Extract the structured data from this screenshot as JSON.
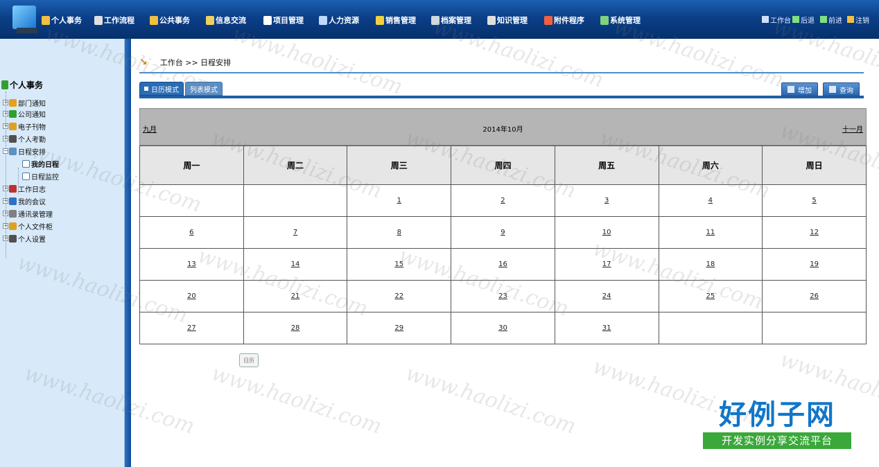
{
  "topnav": {
    "items": [
      {
        "label": "个人事务",
        "icon": "person-icon",
        "color": "#f0c040"
      },
      {
        "label": "工作流程",
        "icon": "workflow-icon",
        "color": "#e0e0e0"
      },
      {
        "label": "公共事务",
        "icon": "public-affairs-icon",
        "color": "#f0c040"
      },
      {
        "label": "信息交流",
        "icon": "message-icon",
        "color": "#f0d060"
      },
      {
        "label": "项目管理",
        "icon": "project-icon",
        "color": "#ffffff"
      },
      {
        "label": "人力资源",
        "icon": "hr-icon",
        "color": "#c0d8ff"
      },
      {
        "label": "销售管理",
        "icon": "sales-icon",
        "color": "#f0d040"
      },
      {
        "label": "档案管理",
        "icon": "archive-icon",
        "color": "#d0d8e0"
      },
      {
        "label": "知识管理",
        "icon": "knowledge-icon",
        "color": "#e0e0e0"
      },
      {
        "label": "附件程序",
        "icon": "attachment-icon",
        "color": "#f06040"
      },
      {
        "label": "系统管理",
        "icon": "system-icon",
        "color": "#80d080"
      }
    ],
    "right": [
      {
        "label": "工作台",
        "icon": "desk-icon"
      },
      {
        "label": "后退",
        "icon": "back-icon"
      },
      {
        "label": "前进",
        "icon": "forward-icon"
      },
      {
        "label": "注销",
        "icon": "logout-icon"
      }
    ]
  },
  "sidebar": {
    "root": "个人事务",
    "items": [
      {
        "label": "部门通知",
        "icon": "department-notice-icon",
        "color": "#e8a020"
      },
      {
        "label": "公司通知",
        "icon": "company-notice-icon",
        "color": "#30a030"
      },
      {
        "label": "电子刊物",
        "icon": "ejournal-icon",
        "color": "#e0a020"
      },
      {
        "label": "个人考勤",
        "icon": "attendance-icon",
        "color": "#505050"
      },
      {
        "label": "日程安排",
        "icon": "schedule-icon",
        "color": "#6090c0"
      },
      {
        "label": "我的日程",
        "icon": "my-schedule-icon",
        "sub": true
      },
      {
        "label": "日程监控",
        "icon": "schedule-monitor-icon",
        "sub": true
      },
      {
        "label": "工作日志",
        "icon": "worklog-icon",
        "color": "#c03030"
      },
      {
        "label": "我的会议",
        "icon": "meeting-icon",
        "color": "#3070c0"
      },
      {
        "label": "通讯录管理",
        "icon": "addressbook-icon",
        "color": "#808080"
      },
      {
        "label": "个人文件柜",
        "icon": "file-cabinet-icon",
        "color": "#e0a020"
      },
      {
        "label": "个人设置",
        "icon": "settings-icon",
        "color": "#505050"
      }
    ]
  },
  "breadcrumb": "工作台 >> 日程安排",
  "tabs": {
    "active": "日历模式",
    "inactive": "列表模式"
  },
  "toolbar": {
    "add": "增加",
    "search": "查询"
  },
  "calendar": {
    "prev": "九月",
    "title": "2014年10月",
    "next": "十一月",
    "weekdays": [
      "周一",
      "周二",
      "周三",
      "周四",
      "周五",
      "周六",
      "周日"
    ],
    "weeks": [
      [
        "",
        "",
        "1",
        "2",
        "3",
        "4",
        "5"
      ],
      [
        "6",
        "7",
        "8",
        "9",
        "10",
        "11",
        "12"
      ],
      [
        "13",
        "14",
        "15",
        "16",
        "17",
        "18",
        "19"
      ],
      [
        "20",
        "21",
        "22",
        "23",
        "24",
        "25",
        "26"
      ],
      [
        "27",
        "28",
        "29",
        "30",
        "31",
        "",
        ""
      ]
    ]
  },
  "small_button": "日历",
  "watermark": "www.haolizi.com",
  "brand": {
    "title": "好例子网",
    "subtitle": "开发实例分享交流平台"
  }
}
